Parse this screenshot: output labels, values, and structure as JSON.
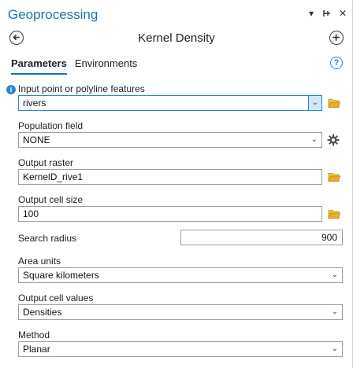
{
  "pane": {
    "title": "Geoprocessing",
    "controls": {
      "menu": "▾",
      "pin": "⊣",
      "close": "✕"
    }
  },
  "tool": {
    "name": "Kernel Density",
    "back_icon": "back-arrow-icon",
    "add_icon": "add-icon"
  },
  "tabs": [
    {
      "label": "Parameters",
      "active": true
    },
    {
      "label": "Environments",
      "active": false
    }
  ],
  "help": {
    "label": "?"
  },
  "params": {
    "input": {
      "label": "Input point or polyline features",
      "value": "rivers",
      "info": "i"
    },
    "population": {
      "label": "Population field",
      "value": "NONE"
    },
    "output_raster": {
      "label": "Output raster",
      "value": "KernelD_rive1"
    },
    "cell_size": {
      "label": "Output cell size",
      "value": "100"
    },
    "search_radius": {
      "label": "Search radius",
      "value": "900"
    },
    "area_units": {
      "label": "Area units",
      "value": "Square kilometers"
    },
    "cell_values": {
      "label": "Output cell values",
      "value": "Densities"
    },
    "method": {
      "label": "Method",
      "value": "Planar"
    }
  },
  "colors": {
    "accent": "#1a73b8",
    "folder": "#e8b020"
  }
}
